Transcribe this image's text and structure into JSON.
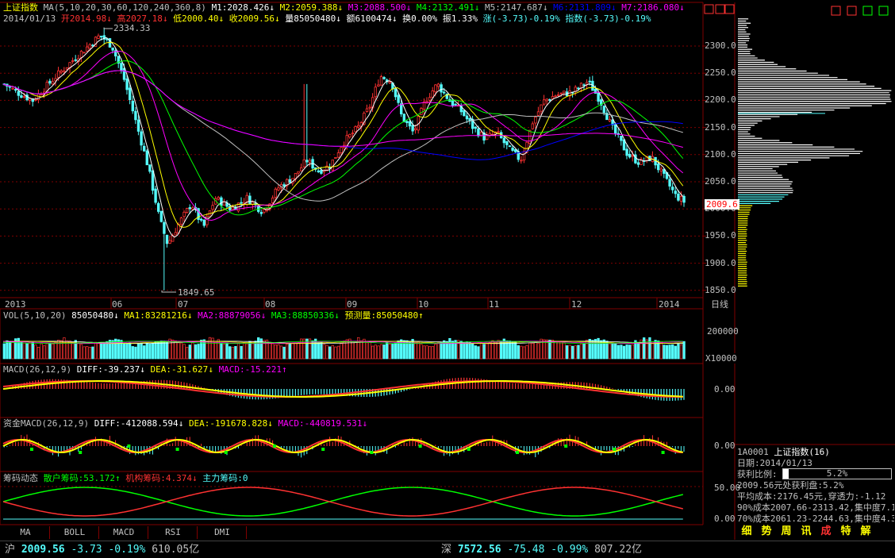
{
  "colors": {
    "up": "#ff3232",
    "down": "#54fcfc",
    "yellow": "#ffff00",
    "white": "#ffffff",
    "magenta": "#ff00ff",
    "green": "#00ff00",
    "blue": "#0000ff",
    "frame": "#800000",
    "grid": "#800000"
  },
  "header": {
    "index_name": "上证指数",
    "ma_title": "MA(5,10,20,30,60,120,240,360,8)",
    "ma_values": [
      {
        "label": "M1:2028.426",
        "arrow": "↓",
        "color": "#ffffff"
      },
      {
        "label": "M2:2059.388",
        "arrow": "↓",
        "color": "#ffff00"
      },
      {
        "label": "M3:2088.500",
        "arrow": "↓",
        "color": "#ff00ff"
      },
      {
        "label": "M4:2132.491",
        "arrow": "↓",
        "color": "#00ff00"
      },
      {
        "label": "M5:2147.687",
        "arrow": "↓",
        "color": "#c0c0c0"
      },
      {
        "label": "M6:2131.809",
        "arrow": "↓",
        "color": "#0000ff"
      },
      {
        "label": "M7:2186.080",
        "arrow": "↓",
        "color": "#ff00ff"
      }
    ],
    "date": "2014/01/13",
    "open": "开2014.98",
    "open_arrow": "↓",
    "high": "高2027.18",
    "high_arrow": "↓",
    "low": "低2000.40",
    "low_arrow": "↓",
    "close": "收2009.56",
    "close_arrow": "↓",
    "volume": "量85050480",
    "volume_arrow": "↓",
    "amount": "额6100474",
    "amount_arrow": "↓",
    "turnover": "换0.00%",
    "amplitude": "振1.33%",
    "change": "涨(-3.73)-0.19%",
    "index_change": "指数(-3.73)-0.19%"
  },
  "price_axis": [
    "2300.0",
    "2250.0",
    "2200.0",
    "2150.0",
    "2100.0",
    "2050.0",
    "2000.0",
    "1950.0",
    "1900.0",
    "1850.0"
  ],
  "current_price_tag": "2009.6",
  "annotations": {
    "high_mark": "2334.33",
    "low_mark": "1849.65"
  },
  "date_axis": {
    "labels": [
      "2013",
      "06",
      "07",
      "08",
      "09",
      "10",
      "11",
      "12",
      "2014"
    ],
    "period_button": "日线"
  },
  "vol_panel": {
    "title": "VOL(5,10,20)",
    "items": [
      {
        "label": "85050480",
        "arrow": "↓",
        "color": "#ffffff"
      },
      {
        "label": "MA1:83281216",
        "arrow": "↓",
        "color": "#ffff00"
      },
      {
        "label": "MA2:88879056",
        "arrow": "↓",
        "color": "#ff00ff"
      },
      {
        "label": "MA3:88850336",
        "arrow": "↓",
        "color": "#00ff00"
      },
      {
        "label": "预测量:85050480",
        "arrow": "↑",
        "color": "#ffff00"
      }
    ],
    "axis_top": "200000",
    "axis_unit": "X10000"
  },
  "macd_panel": {
    "title": "MACD(26,12,9)",
    "items": [
      {
        "label": "DIFF:-39.237",
        "arrow": "↓",
        "color": "#ffffff"
      },
      {
        "label": "DEA:-31.627",
        "arrow": "↓",
        "color": "#ffff00"
      },
      {
        "label": "MACD:-15.221",
        "arrow": "↑",
        "color": "#ff00ff"
      }
    ],
    "axis_zero": "0.00"
  },
  "fund_macd_panel": {
    "title": "资金MACD(26,12,9)",
    "items": [
      {
        "label": "DIFF:-412088.594",
        "arrow": "↓",
        "color": "#ffffff"
      },
      {
        "label": "DEA:-191678.828",
        "arrow": "↓",
        "color": "#ffff00"
      },
      {
        "label": "MACD:-440819.531",
        "arrow": "↓",
        "color": "#ff00ff"
      }
    ],
    "axis_zero": "0.00"
  },
  "chip_panel": {
    "title": "筹码动态",
    "items": [
      {
        "label": "散户筹码:53.172",
        "arrow": "↑",
        "color": "#00ff00"
      },
      {
        "label": "机构筹码:4.374",
        "arrow": "↓",
        "color": "#ff3232"
      },
      {
        "label": "主力筹码:0",
        "arrow": "",
        "color": "#54fcfc"
      }
    ],
    "axis_top": "50.00",
    "axis_zero": "0.00"
  },
  "indicator_tabs": [
    "MA",
    "BOLL",
    "MACD",
    "RSI",
    "DMI"
  ],
  "side_panel": {
    "stock_code": "1A0001",
    "stock_name": "上证指数(16)",
    "date_line": "日期:2014/01/13",
    "profit_label": "获利比例:",
    "profit_value": "5.2%",
    "profit_ratio": 0.052,
    "line1": "2009.56元处获利盘:5.2%",
    "line2": "平均成本:2176.45元,穿透力:-1.12",
    "line3": "90%成本2007.66-2313.42,集中度7.1",
    "line4": "70%成本2061.23-2244.63,集中度4.3",
    "tabs": [
      {
        "label": "细",
        "color": "#ffff00"
      },
      {
        "label": "势",
        "color": "#ffff00"
      },
      {
        "label": "周",
        "color": "#ffff00"
      },
      {
        "label": "讯",
        "color": "#ffff00"
      },
      {
        "label": "成",
        "color": "#ff3232"
      },
      {
        "label": "特",
        "color": "#ffff00"
      },
      {
        "label": "解",
        "color": "#ffff00"
      }
    ]
  },
  "status_bar": {
    "sh_label": "沪",
    "sh_index": "2009.56",
    "sh_change": "-3.73",
    "sh_pct": "-0.19%",
    "sh_amount": "610.05亿",
    "sz_label": "深",
    "sz_index": "7572.56",
    "sz_change": "-75.48",
    "sz_pct": "-0.99%",
    "sz_amount": "807.22亿"
  },
  "window_icons": [
    "pin-icon",
    "restore-icon",
    "close-icon",
    "window-icon",
    "flag-icon",
    "arrow-icon",
    "tools-icon"
  ]
}
